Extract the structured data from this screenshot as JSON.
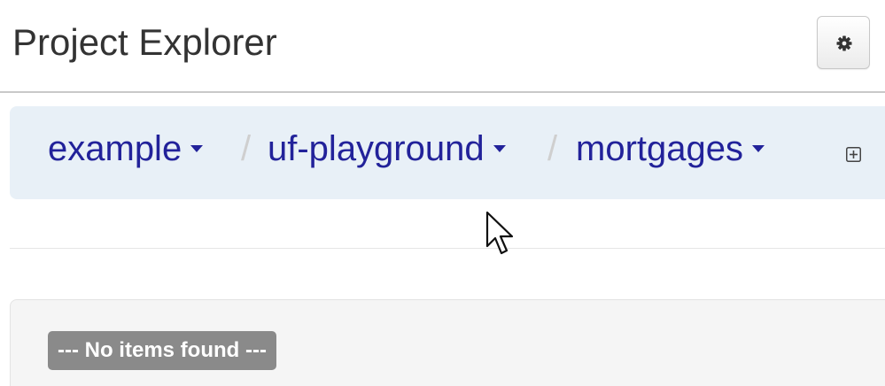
{
  "header": {
    "title": "Project Explorer",
    "settings_icon": "gear-icon"
  },
  "breadcrumb": {
    "items": [
      {
        "label": "example",
        "icon": "caret-down-icon"
      },
      {
        "label": "uf-playground",
        "icon": "caret-down-icon"
      },
      {
        "label": "mortgages",
        "icon": "caret-down-icon"
      }
    ],
    "separator": "/",
    "expand_icon": "expand-square-icon"
  },
  "list": {
    "empty_message": "--- No items found ---"
  },
  "colors": {
    "link": "#22229a",
    "breadcrumb_bg": "#e8f0f7",
    "badge_bg": "#8a8a8a",
    "title": "#333333"
  }
}
